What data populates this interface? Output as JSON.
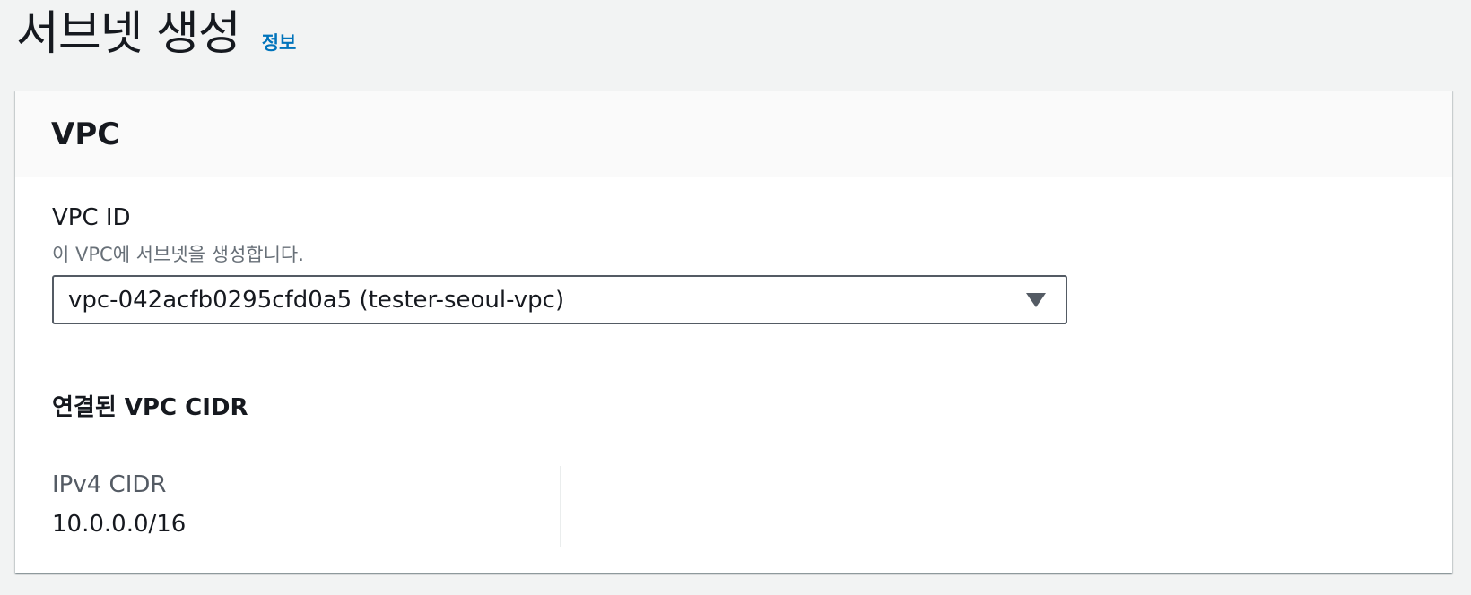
{
  "header": {
    "title": "서브넷 생성",
    "info_link": "정보"
  },
  "vpc_section": {
    "title": "VPC",
    "vpc_id_label": "VPC ID",
    "vpc_id_description": "이 VPC에 서브넷을 생성합니다.",
    "vpc_select_value": "vpc-042acfb0295cfd0a5 (tester-seoul-vpc)",
    "associated_cidr_heading": "연결된 VPC CIDR",
    "ipv4_cidr_label": "IPv4 CIDR",
    "ipv4_cidr_value": "10.0.0.0/16"
  },
  "icons": {
    "select_caret": "caret-down-icon"
  },
  "colors": {
    "page_background": "#f2f3f3",
    "link": "#0073bb",
    "text_primary": "#16191f",
    "text_secondary": "#687078"
  }
}
